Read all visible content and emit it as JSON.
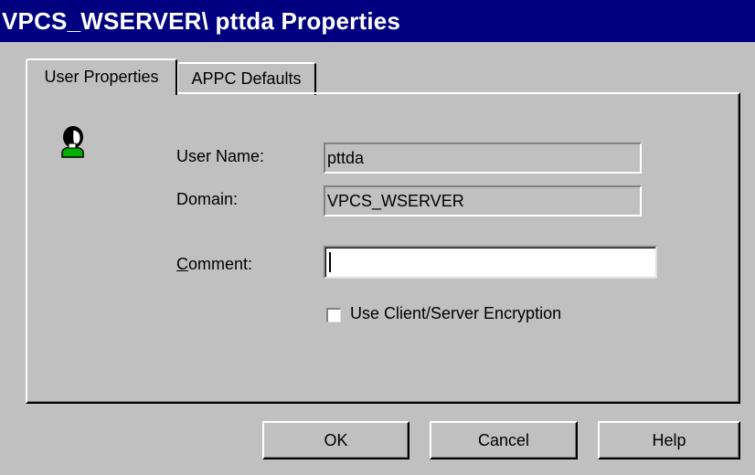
{
  "window": {
    "title": "VPCS_WSERVER\\ pttda Properties"
  },
  "tabs": [
    {
      "label": "User Properties",
      "active": true
    },
    {
      "label": "APPC Defaults",
      "active": false
    }
  ],
  "icons": {
    "user": "user-icon"
  },
  "form": {
    "user_name_label": "User Name:",
    "user_name_value": "pttda",
    "domain_label": "Domain:",
    "domain_value": "VPCS_WSERVER",
    "comment_label_mnemonic": "C",
    "comment_label_rest": "omment:",
    "comment_value": "",
    "encryption_label": "Use Client/Server Encryption",
    "encryption_checked": false
  },
  "buttons": {
    "ok": "OK",
    "cancel": "Cancel",
    "help": "Help"
  },
  "colors": {
    "titlebar": "#000080",
    "face": "#c0c0c0"
  }
}
